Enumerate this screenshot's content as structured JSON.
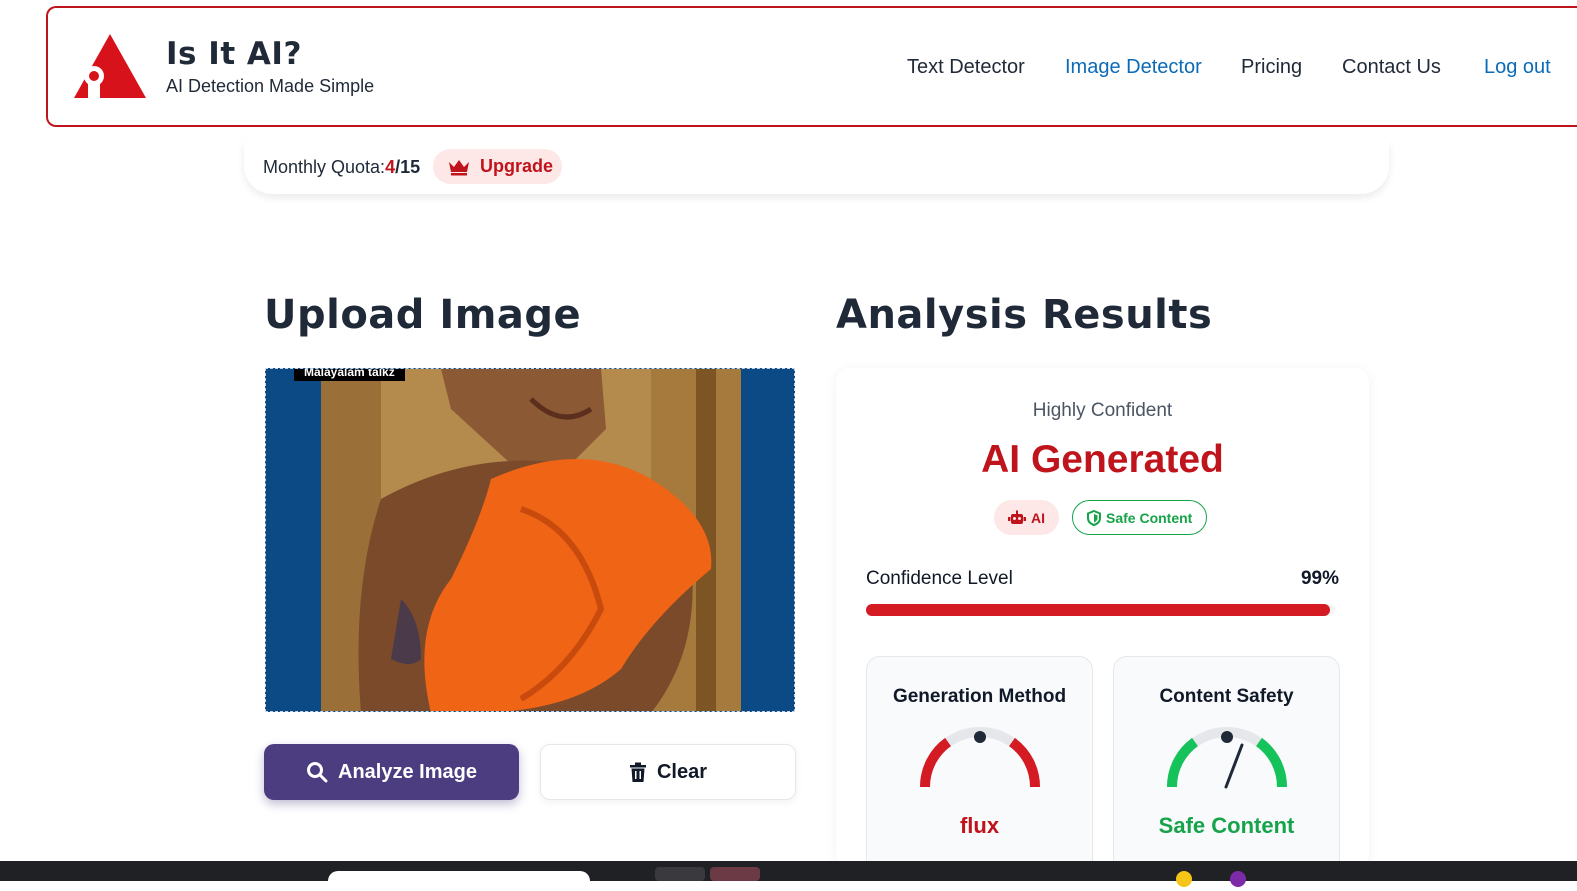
{
  "header": {
    "title": "Is It AI?",
    "subtitle": "AI Detection Made Simple",
    "logo_icon": "warning-triangle-eye-icon",
    "brand_color": "#c0141c",
    "nav": {
      "text_detector": "Text Detector",
      "image_detector": "Image Detector",
      "pricing": "Pricing",
      "contact_us": "Contact Us",
      "log_out": "Log out"
    }
  },
  "quota": {
    "label": "Monthly Quota:",
    "used": "4",
    "separator": "/",
    "total": "15",
    "upgrade_label": "Upgrade",
    "upgrade_icon": "crown-icon"
  },
  "upload": {
    "heading": "Upload Image",
    "image_caption": "Malayalam talkz",
    "analyze_label": "Analyze Image",
    "analyze_icon": "search-icon",
    "clear_label": "Clear",
    "clear_icon": "trash-icon"
  },
  "results": {
    "heading": "Analysis Results",
    "confidence_text": "Highly Confident",
    "verdict": "AI Generated",
    "badges": {
      "ai": {
        "label": "AI",
        "icon": "robot-icon"
      },
      "safe": {
        "label": "Safe Content",
        "icon": "shield-icon"
      }
    },
    "confidence_label": "Confidence Level",
    "confidence_value": "99%",
    "confidence_fraction": 0.99,
    "generation_method": {
      "title": "Generation Method",
      "value": "flux",
      "color": "#c0141c"
    },
    "content_safety": {
      "title": "Content Safety",
      "value": "Safe Content",
      "color": "#16a34a"
    }
  }
}
